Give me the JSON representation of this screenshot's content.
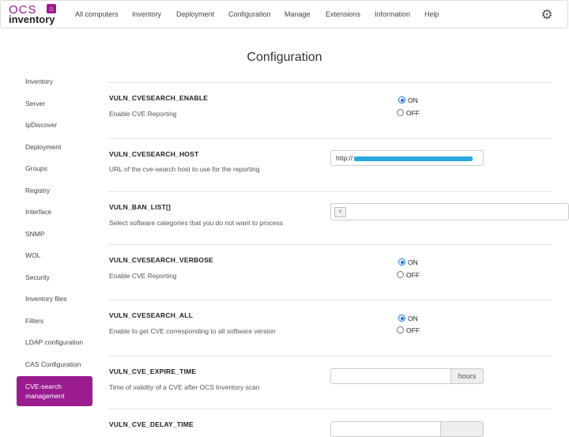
{
  "brand": {
    "logo_top": "OCS",
    "logo_bottom": "inventory",
    "color": "#9b1c8f"
  },
  "nav": [
    "All computers",
    "Inventory",
    "Deployment",
    "Configuration",
    "Manage",
    "Extensions",
    "Information",
    "Help"
  ],
  "settings_icon": "gear-icon",
  "page_title": "Configuration",
  "sidebar": {
    "items": [
      "Inventory",
      "Server",
      "IpDiscover",
      "Deployment",
      "Groups",
      "Registry",
      "Interface",
      "SNMP",
      "WOL",
      "Security",
      "Inventory files",
      "Filters",
      "LDAP configuration",
      "CAS Configuration"
    ],
    "active": [
      "CVE-search",
      "management"
    ]
  },
  "settings": {
    "enable": {
      "key": "VULN_CVESEARCH_ENABLE",
      "desc": "Enable CVE Reporting",
      "on": "ON",
      "off": "OFF",
      "selected": "ON"
    },
    "host": {
      "key": "VULN_CVESEARCH_HOST",
      "desc": "URL of the cve-search host to use for the reporting",
      "value": "http://"
    },
    "ban": {
      "key": "VULN_BAN_LIST[]",
      "desc": "Select software categories that you do not want to process",
      "chip": "×"
    },
    "verbose": {
      "key": "VULN_CVESEARCH_VERBOSE",
      "desc": "Enable CVE Reporting",
      "on": "ON",
      "off": "OFF",
      "selected": "ON"
    },
    "all": {
      "key": "VULN_CVESEARCH_ALL",
      "desc": "Enable to get CVE corresponding to all software version",
      "on": "ON",
      "off": "OFF",
      "selected": "ON"
    },
    "expire": {
      "key": "VULN_CVE_EXPIRE_TIME",
      "desc": "Time of validity of a CVE after OCS Inventory scan",
      "unit": "hours"
    },
    "delay": {
      "key": "VULN_CVE_DELAY_TIME"
    }
  }
}
